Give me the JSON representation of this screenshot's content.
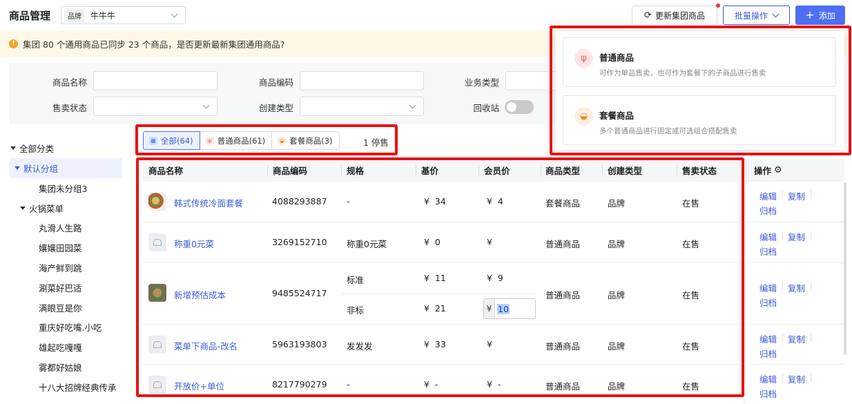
{
  "header": {
    "title": "商品管理",
    "brand_tag": "品牌",
    "brand_value": "牛牛牛",
    "refresh_label": "更新集团商品",
    "batch_label": "批量操作",
    "add_label": "添加"
  },
  "notice": {
    "text": "集团 80 个通用商品已同步 23 个商品，是否更新最新集团通用商品?"
  },
  "filters": {
    "name_label": "商品名称",
    "code_label": "商品编码",
    "biz_label": "业务类型",
    "status_label": "售卖状态",
    "create_label": "创建类型",
    "recycle_label": "回收站"
  },
  "sidebar": {
    "items": [
      {
        "label": "全部分类"
      },
      {
        "label": "默认分组"
      },
      {
        "label": "集团未分组3"
      },
      {
        "label": "火锅菜单"
      },
      {
        "label": "丸滑人生路"
      },
      {
        "label": "孃孃田园菜"
      },
      {
        "label": "海产鲜到跳"
      },
      {
        "label": "涮菜好巴适"
      },
      {
        "label": "满眼豆是你"
      },
      {
        "label": "重庆好吃嘴.小吃"
      },
      {
        "label": "雄起吃嘎嘎"
      },
      {
        "label": "雾都好姑娘"
      },
      {
        "label": "十八大招牌经典传承"
      }
    ]
  },
  "tabs": {
    "all": "全部(64)",
    "normal": "普通商品(61)",
    "set": "套餐商品(3)",
    "stopped": "1 停售"
  },
  "table": {
    "headers": {
      "name": "商品名称",
      "code": "商品编码",
      "spec": "规格",
      "base": "基价",
      "member": "会员价",
      "type": "商品类型",
      "create": "创建类型",
      "status": "售卖状态",
      "ops": "操作"
    },
    "currency": "¥",
    "rows": [
      {
        "name": "韩式传统冷面套餐",
        "code": "4088293887",
        "spec": "-",
        "base": "34",
        "member": "4",
        "type": "套餐商品",
        "create": "品牌",
        "status": "在售"
      },
      {
        "name": "称重0元菜",
        "code": "3269152710",
        "spec": "称重0元菜",
        "base": "0",
        "member": "",
        "type": "普通商品",
        "create": "品牌",
        "status": "在售"
      },
      {
        "name": "新增预估成本",
        "code": "9485524717",
        "spec": "标准",
        "base": "11",
        "member": "9",
        "spec2": "非标",
        "base2": "21",
        "member2": "10",
        "type": "普通商品",
        "create": "品牌",
        "status": "在售"
      },
      {
        "name": "菜单下商品-改名",
        "code": "5963193803",
        "spec": "发发发",
        "base": "33",
        "member": "",
        "type": "普通商品",
        "create": "品牌",
        "status": "在售"
      },
      {
        "name": "开放价+单位",
        "code": "8217790279",
        "spec": "-",
        "base": "-",
        "member": "-",
        "type": "普通商品",
        "create": "品牌",
        "status": "在售"
      }
    ],
    "op_edit": "编辑",
    "op_copy": "复制",
    "op_archive": "归档"
  },
  "dropdown": {
    "normal_title": "普通商品",
    "normal_desc": "可作为单品售卖，也可作为套餐下的子商品进行售卖",
    "set_title": "套餐商品",
    "set_desc": "多个普通商品进行固定或可选组合搭配售卖"
  },
  "colors": {
    "accent": "#4d6ef5",
    "link": "#3a5cd6",
    "highlight": "#e81313",
    "notice_bg": "#fff8e6"
  }
}
